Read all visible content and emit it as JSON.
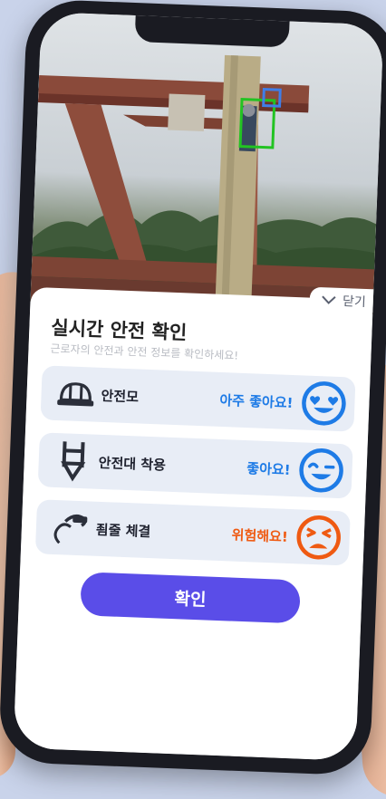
{
  "sheet": {
    "close_label": "닫기",
    "title": "실시간 안전 확인",
    "subtitle": "근로자의 안전과 안전 정보를 확인하세요!"
  },
  "checks": [
    {
      "label": "안전모",
      "status": "아주 좋아요!",
      "icon": "hardhat-icon",
      "face": "heart-eyes-icon",
      "color": "#1e7be6"
    },
    {
      "label": "안전대 착용",
      "status": "좋아요!",
      "icon": "harness-icon",
      "face": "wink-icon",
      "color": "#1e7be6"
    },
    {
      "label": "죔줄 체결",
      "status": "위험해요!",
      "icon": "lanyard-hook-icon",
      "face": "angry-icon",
      "color": "#ef5a12"
    }
  ],
  "confirm_label": "확인",
  "colors": {
    "accent": "#5a4de8",
    "good": "#1e7be6",
    "danger": "#ef5a12",
    "detect_box": "#22c322"
  }
}
